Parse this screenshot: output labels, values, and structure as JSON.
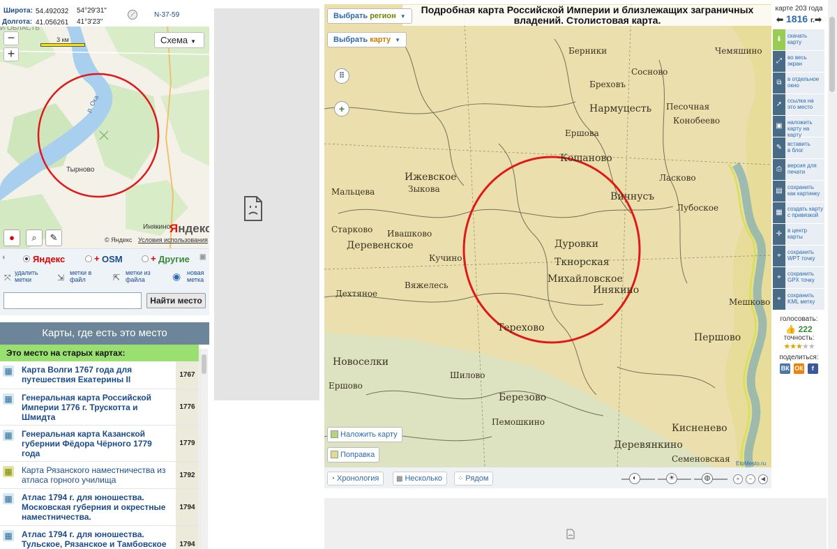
{
  "coords": {
    "lat_label": "Широта:",
    "lat_value": "54.492032",
    "lat_dms": "54°29'31\"",
    "lon_label": "Долгота:",
    "lon_value": "41.056261",
    "lon_dms": "41°3'23\"",
    "sheet": "N-37-59"
  },
  "minimap": {
    "scale_label": "3 км",
    "scheme_label": "Схема",
    "region_text": "И ОБЛАСТЬ",
    "river_label": "р. Ока",
    "town1": "Тырново",
    "town2": "Инякино",
    "yandex_logo_y": "Я",
    "yandex_logo_rest": "ндекс",
    "copyright": "© Яндекс",
    "terms": "Условия использования"
  },
  "providers": {
    "yandex": "Яндекс",
    "osm": "OSM",
    "other": "Другие",
    "plus": "+"
  },
  "actions": {
    "delete_marks": [
      "удалить",
      "метки"
    ],
    "marks_to_file": [
      "метки в",
      "файл"
    ],
    "marks_from_file": [
      "метки из",
      "файла"
    ],
    "new_mark": [
      "новая",
      "метка"
    ]
  },
  "search": {
    "placeholder": "",
    "button": "Найти место"
  },
  "maps_section": {
    "header": "Карты, где есть это место",
    "old_maps_title": "Это место на старых картах:",
    "items": [
      {
        "title": "Карта Волги 1767 года для путешествия Екатерины II",
        "year": "1767",
        "bold": true
      },
      {
        "title": "Генеральная карта Российской Империи 1776 г. Трускотта и Шмидта",
        "year": "1776",
        "bold": true
      },
      {
        "title": "Генеральная карта Казанской губернии Фёдора Чёрного 1779 года",
        "year": "1779",
        "bold": true
      },
      {
        "title": "Карта Рязанского наместничества из атласа горного училища",
        "year": "1792",
        "bold": false
      },
      {
        "title": "Атлас 1794 г. для юношества. Московская губерния и окрестные наместничества.",
        "year": "1794",
        "bold": true
      },
      {
        "title": "Атлас 1794 г. для юношества. Тульское, Рязанское и Тамбовское",
        "year": "1794",
        "bold": true
      }
    ]
  },
  "main_map": {
    "title": "Подробная карта Российской Империи и близлежащих заграничных владений. Столистовая карта.",
    "select_region_a": "Выбрать",
    "select_region_b": "регион",
    "select_map_a": "Выбрать",
    "select_map_b": "карту",
    "overlay_map": "Наложить карту",
    "correction": "Поправка",
    "credit": "EtoMesto.ru",
    "place_labels": [
      "Ижевское",
      "Зыкова",
      "Деревенское",
      "Кучино",
      "Дуровки",
      "Ткнорская",
      "Михайловское",
      "Инякино",
      "Вичнусъ",
      "Кошаново",
      "Терехово",
      "Шилово",
      "Березово",
      "Пемошкино",
      "Кисненево",
      "Деревянкино",
      "Семеновская",
      "Першово",
      "Песочная",
      "Конобеево",
      "Новоселки",
      "Ершово",
      "Дехтяное",
      "Вяжелесь",
      "Старково",
      "Ивашково",
      "Мальцева",
      "Нармуцесть",
      "Ершова",
      "Берники",
      "Мешково",
      "Сосново",
      "Ласково",
      "Бреховъ",
      "Лубоское",
      "Чемяшино"
    ]
  },
  "bottom_bar": {
    "chronology": "Хронология",
    "several": "Несколько",
    "side_by_side": "Рядом"
  },
  "side_panel": {
    "year_caption": "карте 203 года",
    "year": "1816",
    "year_unit": "г.",
    "tools": [
      [
        "скачать",
        "карту"
      ],
      [
        "во весь",
        "экран"
      ],
      [
        "в отдельное",
        "окно"
      ],
      [
        "ссылка на",
        "это место"
      ],
      [
        "наложить",
        "карту на карту"
      ],
      [
        "вставить",
        "в блог"
      ],
      [
        "версия для",
        "печати"
      ],
      [
        "сохранить",
        "как картинку"
      ],
      [
        "создать карту",
        "с привязкой"
      ],
      [
        "в центр",
        "карты"
      ],
      [
        "сохранить",
        "WPT точку"
      ],
      [
        "сохранить",
        "GPX точку"
      ],
      [
        "сохранить",
        "KML метку"
      ]
    ],
    "vote_label": "голосовать:",
    "vote_count": "222",
    "accuracy_label": "точность:",
    "accuracy_stars": 3,
    "share_label": "поделиться:",
    "social": [
      "ВК",
      "ОК",
      "f"
    ]
  },
  "colors": {
    "accent_blue": "#2a6ab0",
    "green_header": "#99e070",
    "section_header": "#6d8598",
    "circle_red": "#e01818"
  }
}
